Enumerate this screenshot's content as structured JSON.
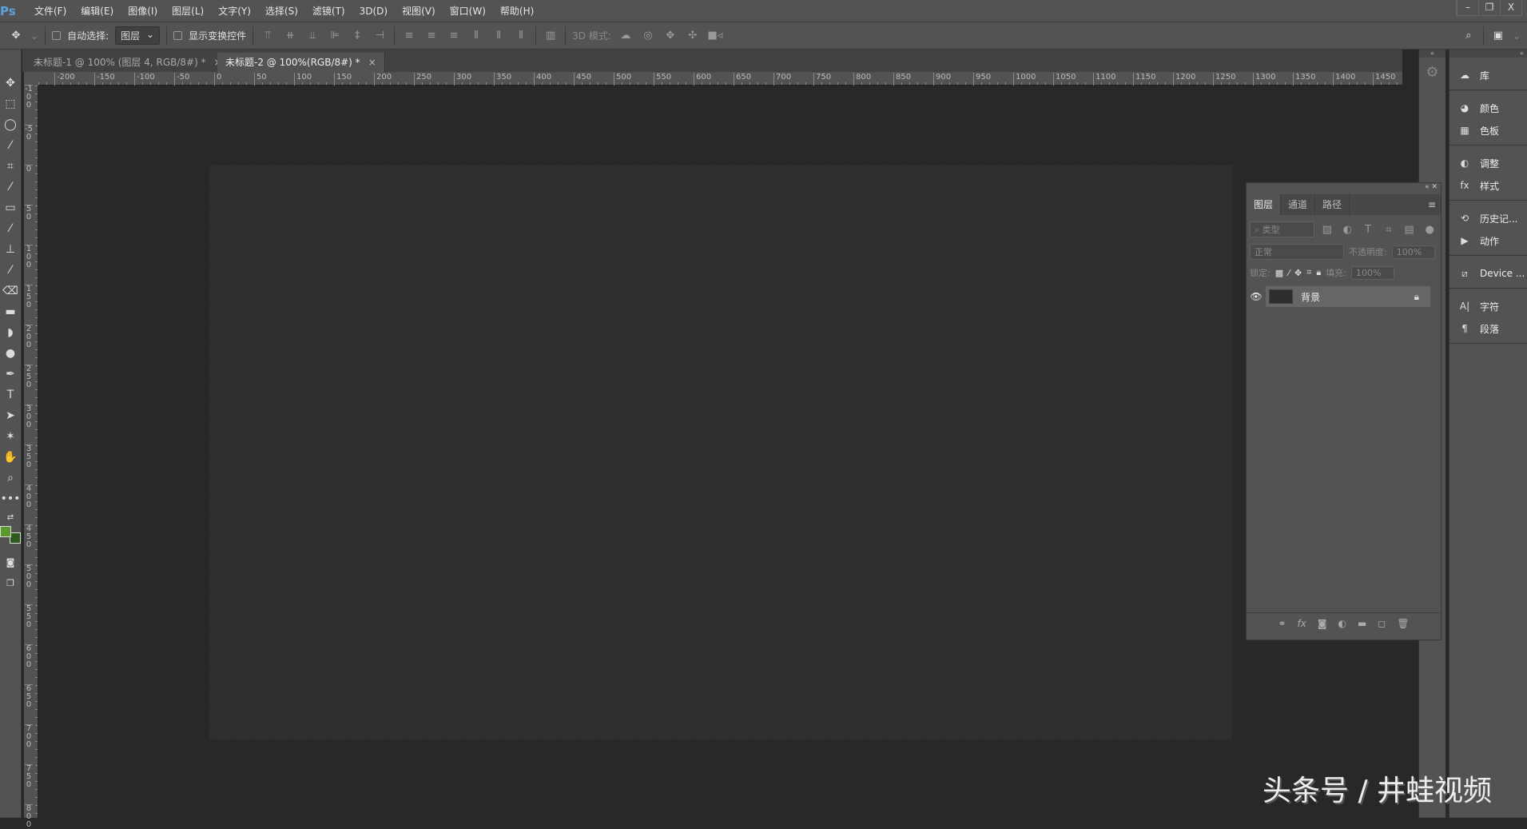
{
  "app": {
    "logo": "Ps"
  },
  "menu": [
    "文件(F)",
    "编辑(E)",
    "图像(I)",
    "图层(L)",
    "文字(Y)",
    "选择(S)",
    "滤镜(T)",
    "3D(D)",
    "视图(V)",
    "窗口(W)",
    "帮助(H)"
  ],
  "window_controls": {
    "minimize": "–",
    "restore": "❐",
    "close": "X"
  },
  "options": {
    "auto_select_label": "自动选择:",
    "auto_select_value": "图层",
    "show_transform_label": "显示变换控件",
    "mode_3d_label": "3D 模式:"
  },
  "tabs": [
    {
      "label": "未标题-1 @ 100% (图层 4, RGB/8#) *",
      "close": "×"
    },
    {
      "label": "未标题-2 @ 100%(RGB/8#) *",
      "close": "×"
    }
  ],
  "h_ruler_labels": [
    -200,
    -150,
    -100,
    -50,
    0,
    50,
    100,
    150,
    200,
    250,
    300,
    350,
    400,
    450,
    500,
    550,
    600,
    650,
    700,
    750,
    800,
    850,
    900,
    950,
    1000,
    1050,
    1100,
    1150,
    1200,
    1250,
    1300,
    1350,
    1400,
    1450
  ],
  "v_ruler_labels": [
    -100,
    -50,
    0,
    50,
    100,
    150,
    200,
    250,
    300,
    350,
    400,
    450,
    500,
    550,
    600,
    650,
    700,
    750,
    800
  ],
  "colors": {
    "foreground": "#5a9a2a",
    "background": "#2f5a1e"
  },
  "right_panels": [
    [
      {
        "icon": "cc-libraries-icon",
        "glyph": "☁",
        "label": "库"
      }
    ],
    [
      {
        "icon": "color-icon",
        "glyph": "◕",
        "label": "颜色"
      },
      {
        "icon": "swatches-icon",
        "glyph": "▦",
        "label": "色板"
      }
    ],
    [
      {
        "icon": "adjustments-icon",
        "glyph": "◐",
        "label": "调整"
      },
      {
        "icon": "styles-icon",
        "glyph": "fx",
        "label": "样式"
      }
    ],
    [
      {
        "icon": "history-icon",
        "glyph": "⟲",
        "label": "历史记..."
      },
      {
        "icon": "actions-icon",
        "glyph": "▶",
        "label": "动作"
      }
    ],
    [
      {
        "icon": "device-preview-icon",
        "glyph": "⧄",
        "label": "Device ..."
      }
    ],
    [
      {
        "icon": "character-icon",
        "glyph": "A|",
        "label": "字符"
      },
      {
        "icon": "paragraph-icon",
        "glyph": "¶",
        "label": "段落"
      }
    ]
  ],
  "layers_panel": {
    "tabs": [
      "图层",
      "通道",
      "路径"
    ],
    "filter_placeholder": "类型",
    "blend_mode": "正常",
    "opacity_label": "不透明度:",
    "opacity_value": "100%",
    "lock_label": "锁定:",
    "fill_label": "填充:",
    "fill_value": "100%",
    "layers": [
      {
        "name": "背景",
        "visible": true,
        "locked": true
      }
    ]
  },
  "watermark": "头条号 / 井蛙视频"
}
